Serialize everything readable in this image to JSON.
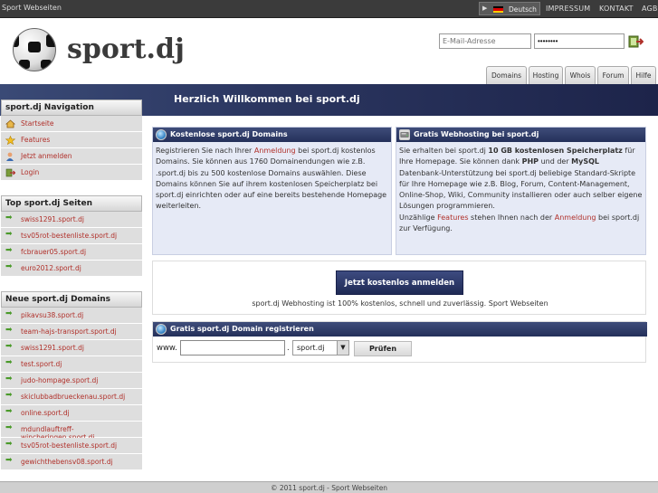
{
  "topbar": {
    "site_title": "Sport Webseiten",
    "language": "Deutsch",
    "links": [
      "IMPRESSUM",
      "KONTAKT",
      "AGB"
    ]
  },
  "header": {
    "logo_text": "sport.dj",
    "email_placeholder": "E-Mail-Adresse",
    "password_value": "••••••••",
    "tabs": [
      "Domains",
      "Hosting",
      "Whois",
      "Forum",
      "Hilfe"
    ]
  },
  "banner": {
    "title": "Herzlich Willkommen bei sport.dj"
  },
  "sidebar": {
    "nav": {
      "title": "sport.dj Navigation",
      "items": [
        "Startseite",
        "Features",
        "Jetzt anmelden",
        "Login"
      ]
    },
    "top": {
      "title": "Top sport.dj Seiten",
      "items": [
        "swiss1291.sport.dj",
        "tsv05rot-bestenliste.sport.dj",
        "fcbrauer05.sport.dj",
        "euro2012.sport.dj"
      ]
    },
    "new": {
      "title": "Neue sport.dj Domains",
      "items": [
        "pikavsu38.sport.dj",
        "team-hajs-transport.sport.dj",
        "swiss1291.sport.dj",
        "test.sport.dj",
        "judo-hompage.sport.dj",
        "skiclubbadbrueckenau.sport.dj",
        "online.sport.dj",
        "mdundlauftreff-wincheringen.sport.dj",
        "tsv05rot-bestenliste.sport.dj",
        "gewichthebensv08.sport.dj"
      ]
    }
  },
  "domains_box": {
    "title": "Kostenlose sport.dj Domains",
    "t1": "Registrieren Sie nach Ihrer ",
    "link": "Anmeldung",
    "t2": " bei sport.dj kostenlos Domains. Sie können aus 1760 Domainendungen wie z.B. .sport.dj bis zu 500 kostenlose Domains auswählen. Diese Domains können Sie auf ihrem kostenlosen Speicherplatz bei sport.dj einrichten oder auf eine bereits bestehende Homepage weiterleiten."
  },
  "hosting_box": {
    "title": "Gratis Webhosting bei sport.dj",
    "t1": "Sie erhalten bei sport.dj ",
    "b1": "10 GB kostenlosen Speicherplatz",
    "t2": " für Ihre Homepage. Sie können dank ",
    "b2": "PHP",
    "t3": " und der ",
    "b3": "MySQL",
    "t4": " Datenbank-Unterstützung bei sport.dj beliebige Standard-Skripte für Ihre Homepage wie z.B. Blog, Forum, Content-Management, Online-Shop, Wiki, Community installieren oder auch selber eigene Lösungen programmieren.",
    "t5": "Unzählige ",
    "link1": "Features",
    "t6": " stehen Ihnen nach der ",
    "link2": "Anmeldung",
    "t7": " bei sport.dj zur Verfügung."
  },
  "signup": {
    "button": "Jetzt kostenlos anmelden",
    "note": "sport.dj Webhosting ist 100% kostenlos, schnell und zuverlässig. Sport Webseiten"
  },
  "register": {
    "title": "Gratis sport.dj Domain registrieren",
    "prefix": "www.",
    "dot": ".",
    "tld": "sport.dj",
    "check_button": "Prüfen"
  },
  "footer": {
    "text": "© 2011 sport.dj - Sport Webseiten"
  },
  "colors": {
    "accent_blue": "#24305a",
    "link_red": "#b0302a",
    "panel_bg": "#e6eaf6"
  }
}
